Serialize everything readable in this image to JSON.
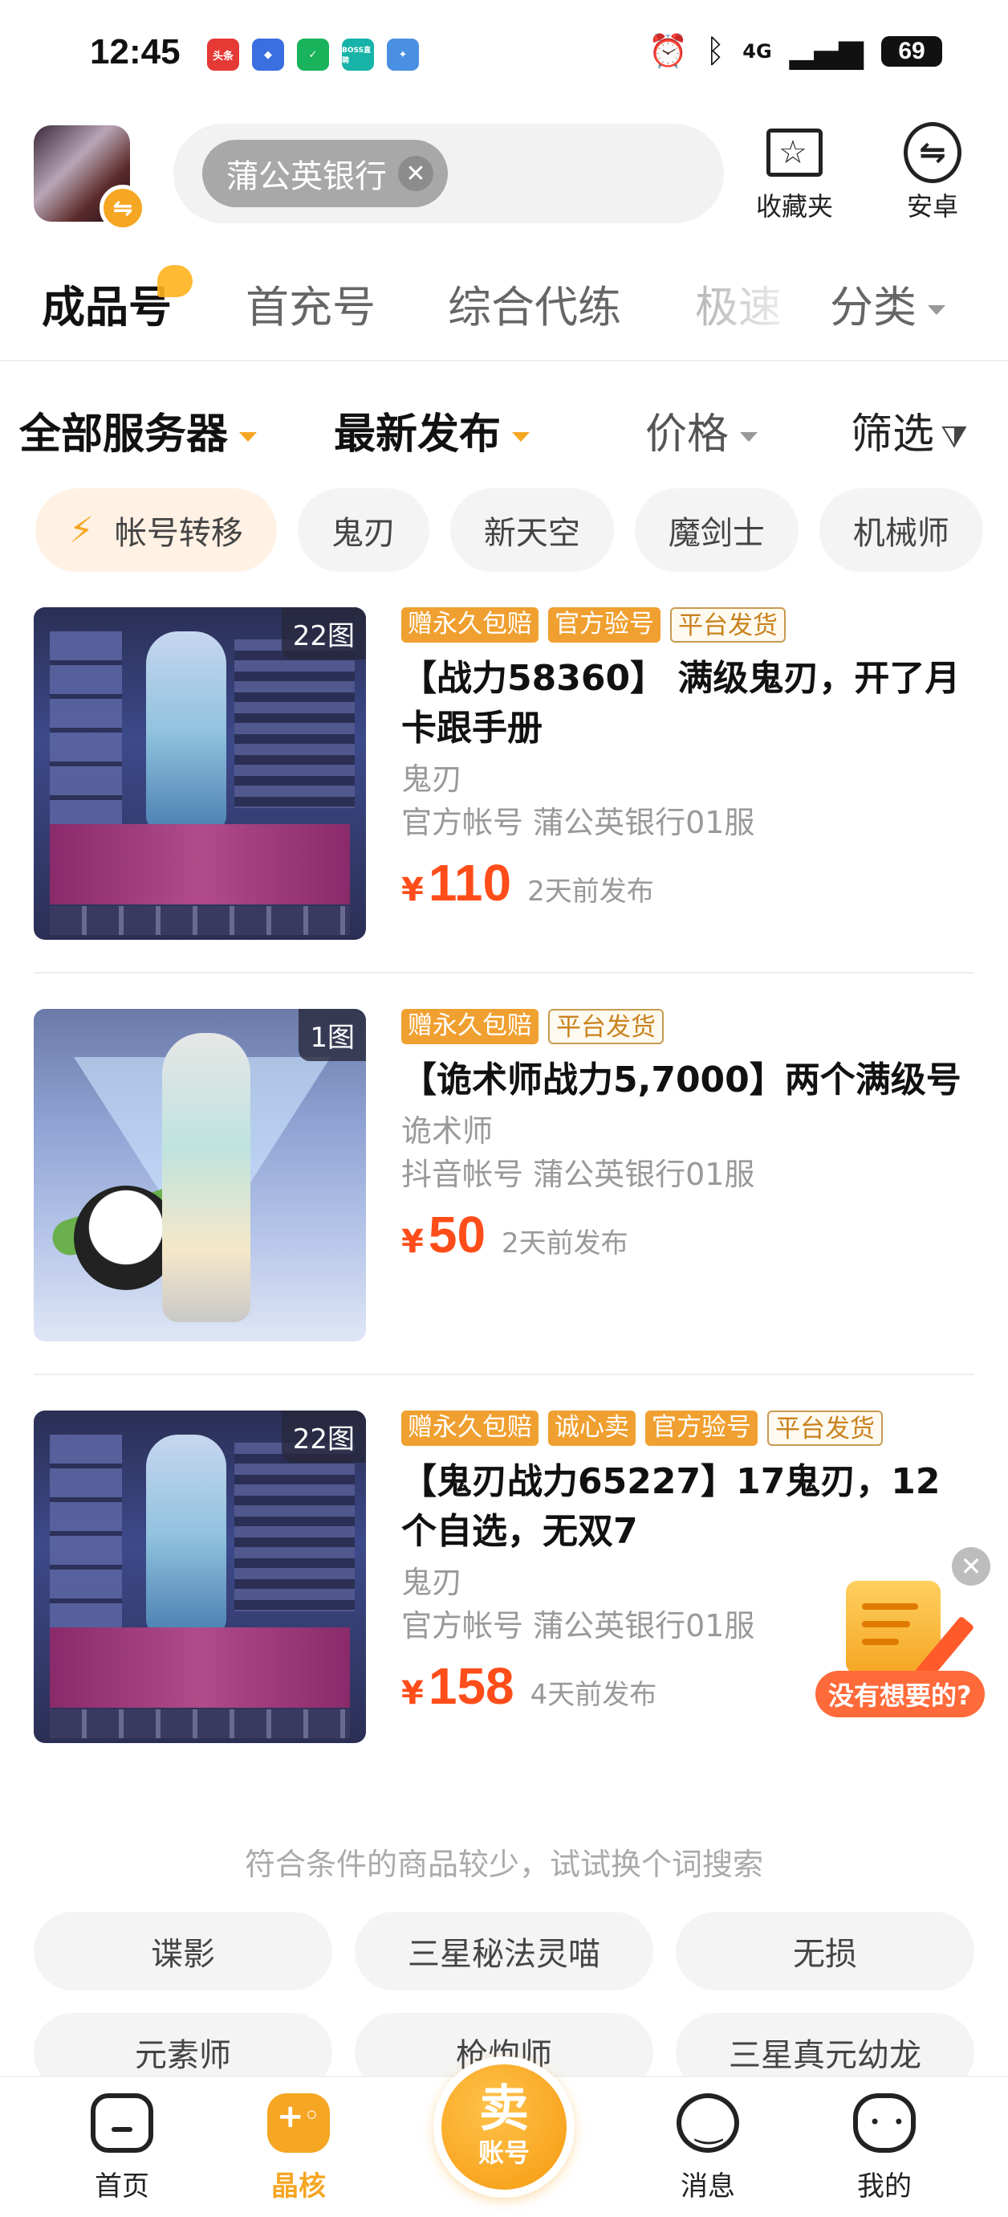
{
  "status_bar": {
    "time": "12:45",
    "apps": [
      {
        "icon": "toutiao-app-icon",
        "text": "头条",
        "color": "#e53935"
      },
      {
        "icon": "game-app-icon",
        "text": "",
        "color": "#3b6fe0"
      },
      {
        "icon": "shield-app-icon",
        "text": "",
        "color": "#19b35b"
      },
      {
        "icon": "boss-app-icon",
        "text": "BOSS直聘",
        "color": "#18b3a8"
      },
      {
        "icon": "feather-app-icon",
        "text": "",
        "color": "#4a90e2"
      }
    ],
    "network": "4G",
    "battery": "69"
  },
  "header": {
    "search_chip": "蒲公英银行",
    "favorites_label": "收藏夹",
    "platform_label": "安卓"
  },
  "category_tabs": [
    "成品号",
    "首充号",
    "综合代练",
    "极速",
    "分类"
  ],
  "sort_bar": {
    "server": "全部服务器",
    "order": "最新发布",
    "price": "价格",
    "filter": "筛选"
  },
  "chips": [
    "帐号转移",
    "鬼刃",
    "新天空",
    "魔剑士",
    "机械师"
  ],
  "listings": [
    {
      "image_count": "22图",
      "tags": [
        {
          "text": "赠永久包赔",
          "style": "solid"
        },
        {
          "text": "官方验号",
          "style": "solid"
        },
        {
          "text": "平台发货",
          "style": "outline"
        }
      ],
      "title": "【战力58360】 满级鬼刃，开了月卡跟手册",
      "class": "鬼刃",
      "account": "官方帐号 蒲公英银行01服",
      "currency": "¥",
      "price": "110",
      "posted": "2天前发布"
    },
    {
      "image_count": "1图",
      "tags": [
        {
          "text": "赠永久包赔",
          "style": "solid"
        },
        {
          "text": "平台发货",
          "style": "outline"
        }
      ],
      "title": "【诡术师战力5,7000】两个满级号",
      "class": "诡术师",
      "account": "抖音帐号 蒲公英银行01服",
      "currency": "¥",
      "price": "50",
      "posted": "2天前发布"
    },
    {
      "image_count": "22图",
      "tags": [
        {
          "text": "赠永久包赔",
          "style": "solid"
        },
        {
          "text": "诚心卖",
          "style": "solid"
        },
        {
          "text": "官方验号",
          "style": "solid"
        },
        {
          "text": "平台发货",
          "style": "outline"
        }
      ],
      "title": "【鬼刃战力65227】17鬼刃，12个自选，无双7",
      "class": "鬼刃",
      "account": "官方帐号 蒲公英银行01服",
      "currency": "¥",
      "price": "158",
      "posted": "4天前发布"
    }
  ],
  "floating_helper": {
    "label": "没有想要的?"
  },
  "suggestions": {
    "hint": "符合条件的商品较少，试试换个词搜索",
    "items": [
      "谍影",
      "三星秘法灵喵",
      "无损",
      "元素师",
      "枪炮师",
      "三星真元幼龙"
    ]
  },
  "bottom_nav": {
    "items": [
      "首页",
      "晶核",
      "消息",
      "我的"
    ],
    "active": "晶核",
    "sell_line1": "卖",
    "sell_line2": "账号"
  },
  "colors": {
    "accent": "#f5a623",
    "price": "#ff4d1a"
  }
}
